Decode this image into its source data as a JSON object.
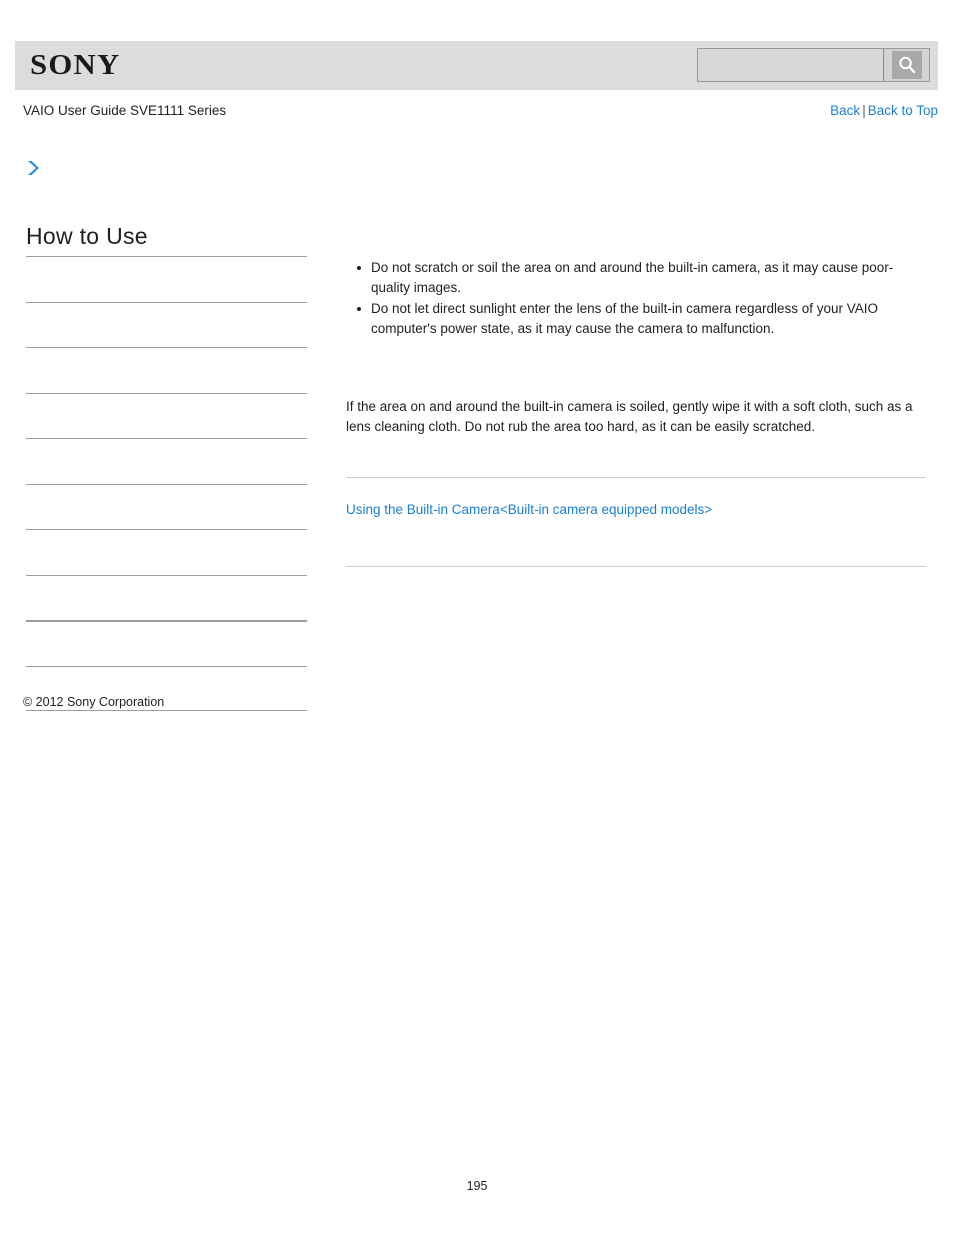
{
  "header": {
    "logo_text": "SONY",
    "search": {
      "value": "",
      "placeholder": "",
      "icon": "search-icon"
    }
  },
  "title_row": {
    "guide_title": "VAIO User Guide SVE1111 Series",
    "back_label": "Back",
    "separator": "|",
    "back_to_top_label": "Back to Top"
  },
  "sidebar": {
    "expand_icon": "chevron-right-icon",
    "heading": "How to Use",
    "items": [
      {
        "label": ""
      },
      {
        "label": ""
      },
      {
        "label": ""
      },
      {
        "label": ""
      },
      {
        "label": ""
      },
      {
        "label": ""
      },
      {
        "label": ""
      },
      {
        "label": ""
      },
      {
        "label": ""
      },
      {
        "label": ""
      }
    ],
    "copyright": "© 2012 Sony Corporation"
  },
  "content": {
    "bullets": [
      "Do not scratch or soil the area on and around the built-in camera, as it may cause poor-quality images.",
      "Do not let direct sunlight enter the lens of the built-in camera regardless of your VAIO computer's power state, as it may cause the camera to malfunction."
    ],
    "paragraph": "If the area on and around the built-in camera is soiled, gently wipe it with a soft cloth, such as a lens cleaning cloth. Do not rub the area too hard, as it can be easily scratched.",
    "related_link": "Using the Built-in Camera<Built-in camera equipped models>"
  },
  "footer": {
    "page_number": "195"
  },
  "colors": {
    "header_bg": "#dcdcdc",
    "link_blue": "#1b7fd4",
    "text": "#231f20",
    "rule_gray": "#cfcfcf",
    "sidebar_rule": "#9d9d9d"
  }
}
